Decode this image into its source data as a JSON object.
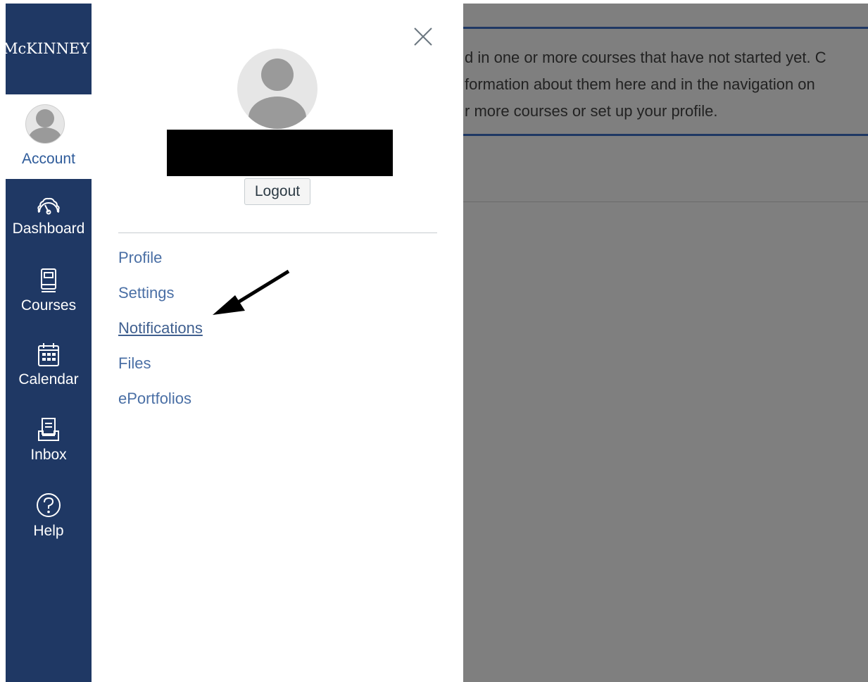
{
  "brand": {
    "logo_text": "McKINNEY"
  },
  "global_nav": {
    "account_label": "Account",
    "items": [
      {
        "label": "Dashboard",
        "icon": "dashboard-icon"
      },
      {
        "label": "Courses",
        "icon": "courses-icon"
      },
      {
        "label": "Calendar",
        "icon": "calendar-icon"
      },
      {
        "label": "Inbox",
        "icon": "inbox-icon"
      },
      {
        "label": "Help",
        "icon": "help-icon"
      }
    ]
  },
  "account_tray": {
    "logout_label": "Logout",
    "links": [
      {
        "label": "Profile"
      },
      {
        "label": "Settings"
      },
      {
        "label": "Notifications"
      },
      {
        "label": "Files"
      },
      {
        "label": "ePortfolios"
      }
    ]
  },
  "background_notice": {
    "lines": [
      "d in one or more courses that have not started yet. C",
      "formation about them here and in the navigation on",
      "r more courses or set up your profile."
    ]
  },
  "colors": {
    "nav_background": "#1f3864",
    "link": "#4a6fa5",
    "overlay": "#7f7f7f"
  }
}
